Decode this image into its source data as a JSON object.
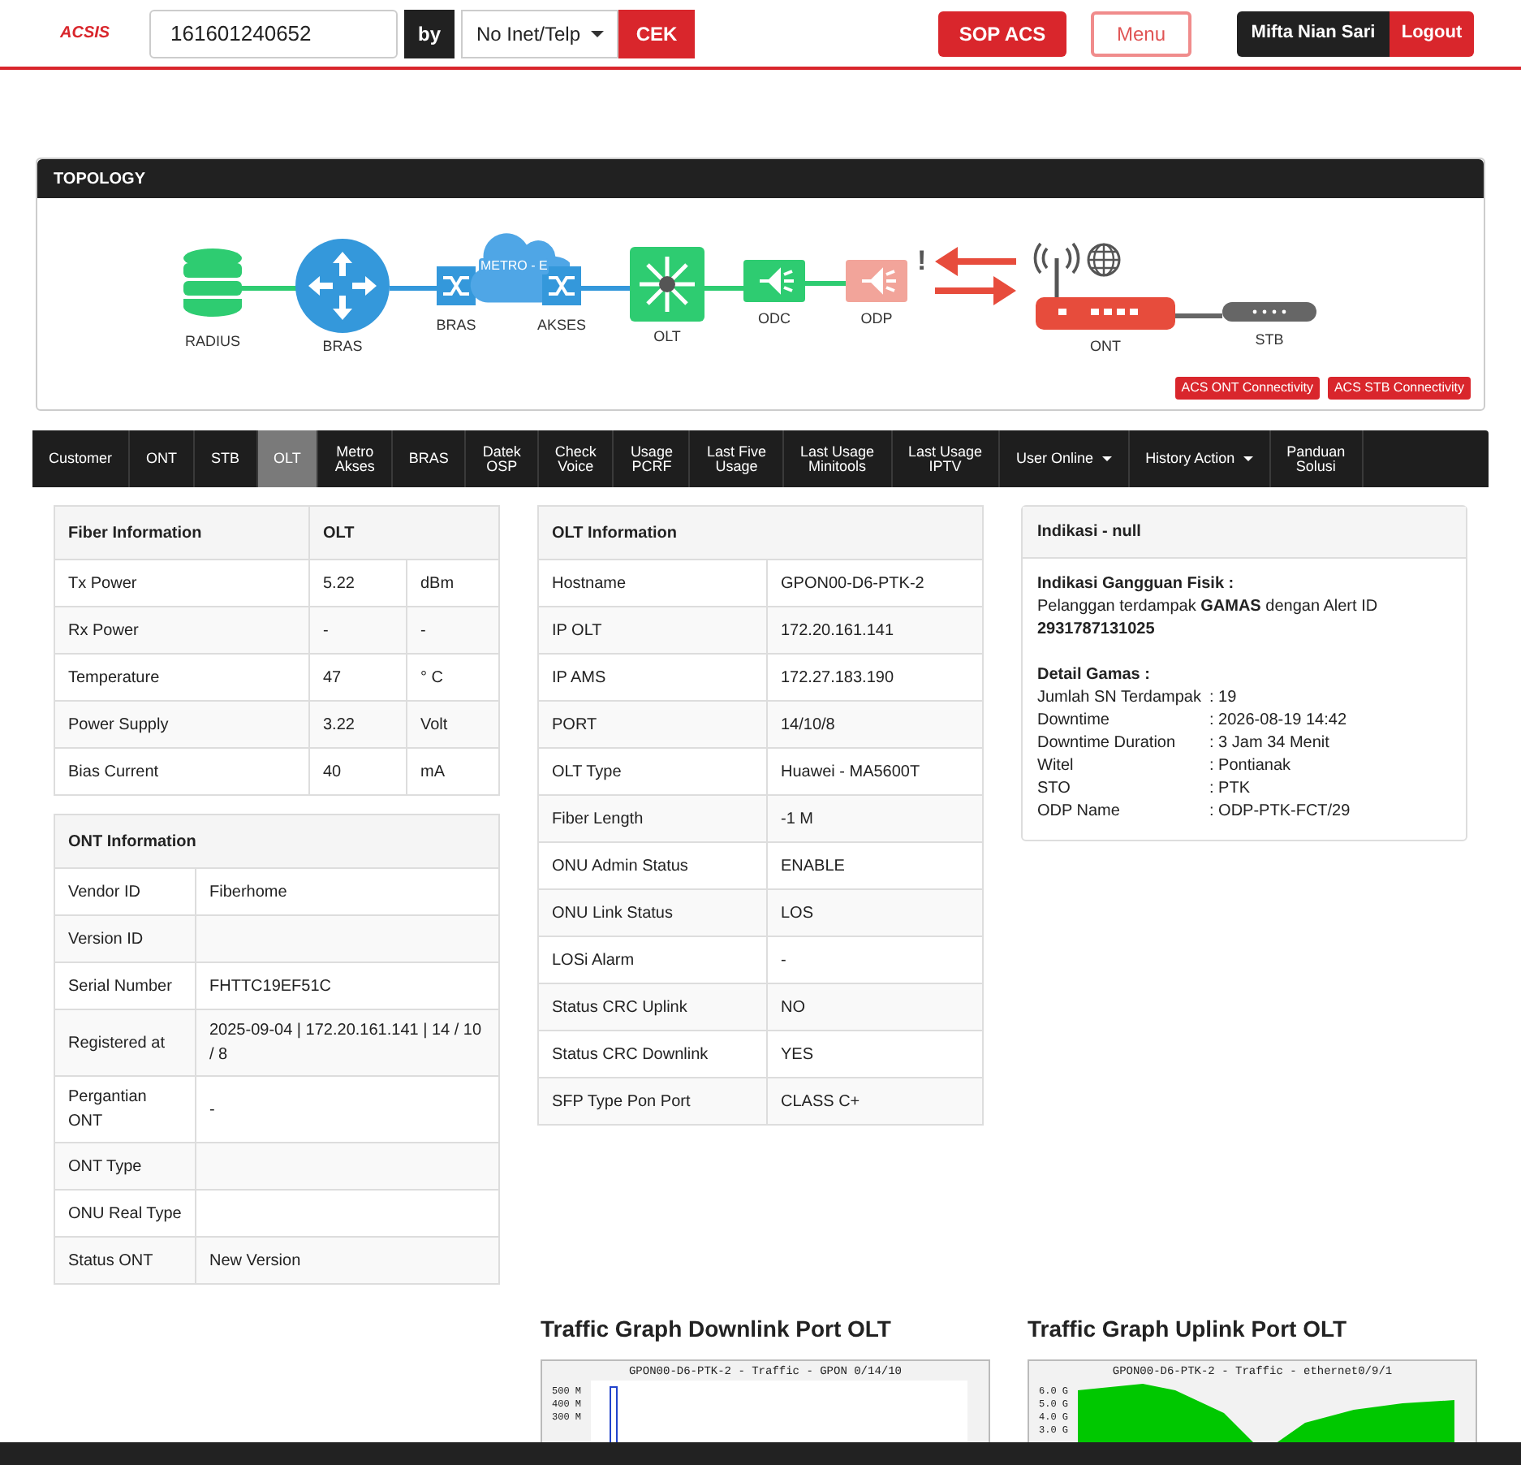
{
  "header": {
    "logo": "ACSIS",
    "search_value": "161601240652",
    "by_label": "by",
    "search_type": "No Inet/Telp",
    "check_button": "CEK",
    "sop_button": "SOP ACS",
    "menu_button": "Menu",
    "user_name": "Mifta Nian Sari",
    "logout_button": "Logout"
  },
  "topology": {
    "title": "TOPOLOGY",
    "alert_mark": "!",
    "nodes": [
      {
        "kind": "database",
        "label": "RADIUS",
        "color": "#2ecc71"
      },
      {
        "kind": "router",
        "label": "BRAS",
        "color": "#3498db"
      },
      {
        "kind": "switch",
        "label": "BRAS",
        "color": "#3498db"
      },
      {
        "kind": "cloud",
        "label": "METRO - E",
        "color": "#4fa6e6"
      },
      {
        "kind": "switch",
        "label": "AKSES",
        "color": "#3498db"
      },
      {
        "kind": "hub",
        "label": "OLT",
        "color": "#2ecc71"
      },
      {
        "kind": "splitter",
        "label": "ODC",
        "color": "#2ecc71"
      },
      {
        "kind": "splitter",
        "label": "ODP",
        "color": "#f2a49a"
      },
      {
        "kind": "ont",
        "label": "ONT",
        "color": "#e74c3c"
      },
      {
        "kind": "stb",
        "label": "STB",
        "color": "#666666"
      }
    ],
    "buttons": [
      "ACS ONT Connectivity",
      "ACS STB Connectivity"
    ]
  },
  "tabs": [
    {
      "label": "Customer",
      "selected": false,
      "dropdown": false
    },
    {
      "label": "ONT",
      "selected": false,
      "dropdown": false
    },
    {
      "label": "STB",
      "selected": false,
      "dropdown": false
    },
    {
      "label": "OLT",
      "selected": true,
      "dropdown": false
    },
    {
      "label": "Metro\nAkses",
      "selected": false,
      "dropdown": false
    },
    {
      "label": "BRAS",
      "selected": false,
      "dropdown": false
    },
    {
      "label": "Datek\nOSP",
      "selected": false,
      "dropdown": false
    },
    {
      "label": "Check\nVoice",
      "selected": false,
      "dropdown": false
    },
    {
      "label": "Usage\nPCRF",
      "selected": false,
      "dropdown": false
    },
    {
      "label": "Last Five\nUsage",
      "selected": false,
      "dropdown": false
    },
    {
      "label": "Last Usage\nMinitools",
      "selected": false,
      "dropdown": false
    },
    {
      "label": "Last Usage\nIPTV",
      "selected": false,
      "dropdown": false
    },
    {
      "label": "User Online",
      "selected": false,
      "dropdown": true
    },
    {
      "label": "History Action",
      "selected": false,
      "dropdown": true
    },
    {
      "label": "Panduan\nSolusi",
      "selected": false,
      "dropdown": false
    }
  ],
  "fiber_information": {
    "title": "Fiber Information",
    "source": "OLT",
    "rows": [
      [
        "Tx Power",
        "5.22",
        "dBm"
      ],
      [
        "Rx Power",
        "-",
        "-"
      ],
      [
        "Temperature",
        "47",
        "° C"
      ],
      [
        "Power Supply",
        "3.22",
        "Volt"
      ],
      [
        "Bias Current",
        "40",
        "mA"
      ]
    ]
  },
  "ont_information": {
    "title": "ONT Information",
    "rows": [
      [
        "Vendor ID",
        "Fiberhome"
      ],
      [
        "Version ID",
        ""
      ],
      [
        "Serial Number",
        "FHTTC19EF51C"
      ],
      [
        "Registered at",
        "2025-09-04 | 172.20.161.141 | 14 / 10 / 8"
      ],
      [
        "Pergantian ONT",
        "-"
      ],
      [
        "ONT Type",
        ""
      ],
      [
        "ONU Real Type",
        ""
      ],
      [
        "Status ONT",
        "New Version"
      ]
    ]
  },
  "olt_information": {
    "title": "OLT Information",
    "rows": [
      [
        "Hostname",
        "GPON00-D6-PTK-2"
      ],
      [
        "IP OLT",
        "172.20.161.141"
      ],
      [
        "IP AMS",
        "172.27.183.190"
      ],
      [
        "PORT",
        "14/10/8"
      ],
      [
        "OLT Type",
        "Huawei - MA5600T"
      ],
      [
        "Fiber Length",
        "-1 M"
      ],
      [
        "ONU Admin Status",
        "ENABLE"
      ],
      [
        "ONU Link Status",
        "LOS"
      ],
      [
        "LOSi Alarm",
        "-"
      ],
      [
        "Status CRC Uplink",
        "NO"
      ],
      [
        "Status CRC Downlink",
        "YES"
      ],
      [
        "SFP Type Pon Port",
        "CLASS C+"
      ]
    ]
  },
  "indication": {
    "title": "Indikasi - null",
    "heading": "Indikasi Gangguan Fisik :",
    "message": "Pelanggan terdampak **GAMAS** dengan Alert ID",
    "alert_id": "2931787131025",
    "detail_heading": "Detail Gamas :",
    "details": [
      [
        "Jumlah SN Terdampak",
        ": 19"
      ],
      [
        "Downtime",
        ": 2026-08-19 14:42"
      ],
      [
        "Downtime Duration",
        ": 3 Jam 34 Menit"
      ],
      [
        "Witel",
        ": Pontianak"
      ],
      [
        "STO",
        ": PTK"
      ],
      [
        "ODP Name",
        ": ODP-PTK-FCT/29"
      ]
    ]
  },
  "graphs": [
    {
      "kind": "line",
      "title": "Traffic Graph Downlink Port OLT",
      "graph_title": "GPON00-D6-PTK-2 - Traffic - GPON 0/14/10",
      "y_tick_labels": [
        "500 M",
        "400 M",
        "300 M"
      ]
    },
    {
      "kind": "area",
      "title": "Traffic Graph Uplink Port OLT",
      "graph_title": "GPON00-D6-PTK-2 - Traffic - ethernet0/9/1",
      "y_tick_labels": [
        "6.0 G",
        "5.0 G",
        "4.0 G",
        "3.0 G"
      ]
    }
  ]
}
